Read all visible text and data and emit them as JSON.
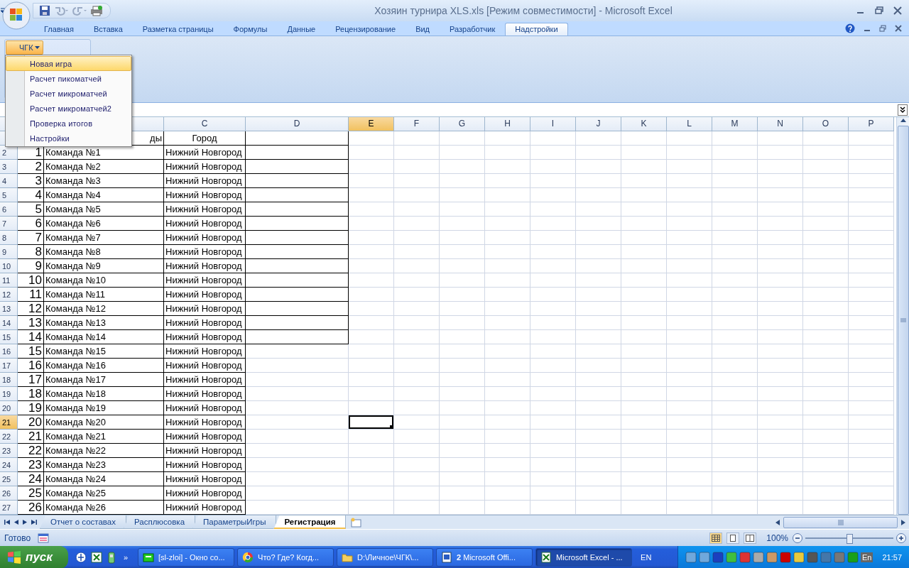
{
  "window": {
    "title": "Хозяин турнира XLS.xls  [Режим совместимости] - Microsoft Excel"
  },
  "ribbon_tabs": [
    {
      "label": "Главная",
      "selected": false
    },
    {
      "label": "Вставка",
      "selected": false
    },
    {
      "label": "Разметка страницы",
      "selected": false
    },
    {
      "label": "Формулы",
      "selected": false
    },
    {
      "label": "Данные",
      "selected": false
    },
    {
      "label": "Рецензирование",
      "selected": false
    },
    {
      "label": "Вид",
      "selected": false
    },
    {
      "label": "Разработчик",
      "selected": false
    },
    {
      "label": "Надстройки",
      "selected": true
    }
  ],
  "menu_button": {
    "label": "ЧГК",
    "expanded": true
  },
  "menu": [
    {
      "label": "Новая игра",
      "selected": true
    },
    {
      "label": "Расчет пикоматчей",
      "selected": false
    },
    {
      "label": "Расчет микроматчей",
      "selected": false
    },
    {
      "label": "Расчет микроматчей2",
      "selected": false
    },
    {
      "label": "Проверка итогов",
      "selected": false
    },
    {
      "label": "Настройки",
      "selected": false
    }
  ],
  "columns": [
    {
      "label": "C",
      "selected": false
    },
    {
      "label": "D",
      "selected": false
    },
    {
      "label": "E",
      "selected": true
    },
    {
      "label": "F",
      "selected": false
    },
    {
      "label": "G",
      "selected": false
    },
    {
      "label": "H",
      "selected": false
    },
    {
      "label": "I",
      "selected": false
    },
    {
      "label": "J",
      "selected": false
    },
    {
      "label": "K",
      "selected": false
    },
    {
      "label": "L",
      "selected": false
    },
    {
      "label": "M",
      "selected": false
    },
    {
      "label": "N",
      "selected": false
    },
    {
      "label": "O",
      "selected": false
    },
    {
      "label": "P",
      "selected": false
    }
  ],
  "header_row": {
    "b": "ды",
    "c": "Город"
  },
  "rows": [
    {
      "header": "2",
      "selected": false,
      "a": "1",
      "b": "Команда №1",
      "c": "Нижний Новгород",
      "d_bordered": true
    },
    {
      "header": "3",
      "selected": false,
      "a": "2",
      "b": "Команда №2",
      "c": "Нижний Новгород",
      "d_bordered": true
    },
    {
      "header": "4",
      "selected": false,
      "a": "3",
      "b": "Команда №3",
      "c": "Нижний Новгород",
      "d_bordered": true
    },
    {
      "header": "5",
      "selected": false,
      "a": "4",
      "b": "Команда №4",
      "c": "Нижний Новгород",
      "d_bordered": true
    },
    {
      "header": "6",
      "selected": false,
      "a": "5",
      "b": "Команда №5",
      "c": "Нижний Новгород",
      "d_bordered": true
    },
    {
      "header": "7",
      "selected": false,
      "a": "6",
      "b": "Команда №6",
      "c": "Нижний Новгород",
      "d_bordered": true
    },
    {
      "header": "8",
      "selected": false,
      "a": "7",
      "b": "Команда №7",
      "c": "Нижний Новгород",
      "d_bordered": true
    },
    {
      "header": "9",
      "selected": false,
      "a": "8",
      "b": "Команда №8",
      "c": "Нижний Новгород",
      "d_bordered": true
    },
    {
      "header": "10",
      "selected": false,
      "a": "9",
      "b": "Команда №9",
      "c": "Нижний Новгород",
      "d_bordered": true
    },
    {
      "header": "11",
      "selected": false,
      "a": "10",
      "b": "Команда №10",
      "c": "Нижний Новгород",
      "d_bordered": true
    },
    {
      "header": "12",
      "selected": false,
      "a": "11",
      "b": "Команда №11",
      "c": "Нижний Новгород",
      "d_bordered": true
    },
    {
      "header": "13",
      "selected": false,
      "a": "12",
      "b": "Команда №12",
      "c": "Нижний Новгород",
      "d_bordered": true
    },
    {
      "header": "14",
      "selected": false,
      "a": "13",
      "b": "Команда №13",
      "c": "Нижний Новгород",
      "d_bordered": true
    },
    {
      "header": "15",
      "selected": false,
      "a": "14",
      "b": "Команда №14",
      "c": "Нижний Новгород",
      "d_bordered": true
    },
    {
      "header": "16",
      "selected": false,
      "a": "15",
      "b": "Команда №15",
      "c": "Нижний Новгород",
      "d_bordered": false
    },
    {
      "header": "17",
      "selected": false,
      "a": "16",
      "b": "Команда №16",
      "c": "Нижний Новгород",
      "d_bordered": false
    },
    {
      "header": "18",
      "selected": false,
      "a": "17",
      "b": "Команда №17",
      "c": "Нижний Новгород",
      "d_bordered": false
    },
    {
      "header": "19",
      "selected": false,
      "a": "18",
      "b": "Команда №18",
      "c": "Нижний Новгород",
      "d_bordered": false
    },
    {
      "header": "20",
      "selected": false,
      "a": "19",
      "b": "Команда №19",
      "c": "Нижний Новгород",
      "d_bordered": false
    },
    {
      "header": "21",
      "selected": true,
      "a": "20",
      "b": "Команда №20",
      "c": "Нижний Новгород",
      "d_bordered": false
    },
    {
      "header": "22",
      "selected": false,
      "a": "21",
      "b": "Команда №21",
      "c": "Нижний Новгород",
      "d_bordered": false
    },
    {
      "header": "23",
      "selected": false,
      "a": "22",
      "b": "Команда №22",
      "c": "Нижний Новгород",
      "d_bordered": false
    },
    {
      "header": "24",
      "selected": false,
      "a": "23",
      "b": "Команда №23",
      "c": "Нижний Новгород",
      "d_bordered": false
    },
    {
      "header": "25",
      "selected": false,
      "a": "24",
      "b": "Команда №24",
      "c": "Нижний Новгород",
      "d_bordered": false
    },
    {
      "header": "26",
      "selected": false,
      "a": "25",
      "b": "Команда №25",
      "c": "Нижний Новгород",
      "d_bordered": false
    },
    {
      "header": "27",
      "selected": false,
      "a": "26",
      "b": "Команда №26",
      "c": "Нижний Новгород",
      "d_bordered": false
    }
  ],
  "sheet_tabs": [
    {
      "label": "Отчет о составах",
      "selected": false
    },
    {
      "label": "Расплюсовка",
      "selected": false
    },
    {
      "label": "ПараметрыИгры",
      "selected": false
    },
    {
      "label": "Регистрация",
      "selected": true
    }
  ],
  "status_bar": {
    "status": "Готово",
    "zoom": "100%",
    "level": 0.5
  },
  "taskbar": {
    "start": "пуск",
    "more": "»",
    "buttons": [
      {
        "label": "[sl-zloi] - Окно со...",
        "kind": "card",
        "selected": false
      },
      {
        "label": "Что? Где? Когд...",
        "kind": "browser",
        "selected": false
      },
      {
        "label": "D:\\Личное\\ЧГК\\...",
        "kind": "folder",
        "selected": false
      },
      {
        "label": "**2** Microsoft Offi...",
        "kind": "word",
        "selected": false
      },
      {
        "label": "Microsoft Excel - ...",
        "kind": "excel",
        "selected": true
      }
    ],
    "language": "EN",
    "tray_language": "En",
    "clock": "21:57"
  }
}
